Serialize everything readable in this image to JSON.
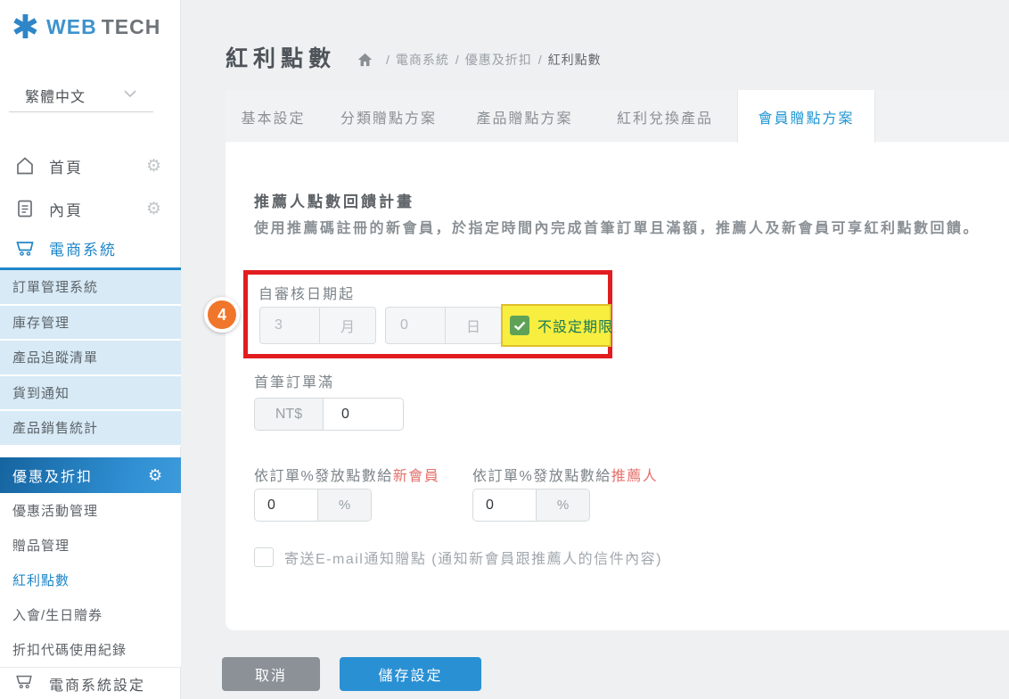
{
  "colors": {
    "brand_blue": "#2389cf",
    "active_tab_text": "#2196d3",
    "submenu_bg": "#d7eaf6",
    "annotation_red": "#e21d20",
    "badge_orange": "#f0762b",
    "highlight_yellow": "#f7ee3f",
    "checkbox_green": "#5fa257",
    "highlight_text_green": "#17795a",
    "label_red": "#e4716c",
    "cancel_gray": "#8b9197",
    "save_blue": "#2a90d4"
  },
  "icons": {
    "logo_mark": "✱",
    "language_chevron": "chevron-down",
    "home": "home-outline",
    "inner_page": "document-outline",
    "cart": "shopping-cart",
    "gear": "⚙",
    "breadcrumb_home": "house-solid",
    "checkmark": "✓"
  },
  "sidebar": {
    "logo": {
      "mark": "✱",
      "web": "WEB",
      "tech": "TECH"
    },
    "language": {
      "value": "繁體中文"
    },
    "menu": [
      {
        "label": "首頁"
      },
      {
        "label": "內頁"
      },
      {
        "label": "電商系統"
      }
    ],
    "submenu": [
      "訂單管理系統",
      "庫存管理",
      "產品追蹤清單",
      "貨到通知",
      "產品銷售統計"
    ],
    "promo_parent": "優惠及折扣",
    "promo_items": [
      "優惠活動管理",
      "贈品管理",
      "紅利點數",
      "入會/生日贈券",
      "折扣代碼使用紀錄"
    ],
    "active_item": "紅利點數",
    "footer_item": "電商系統設定"
  },
  "header": {
    "title": "紅利點數",
    "breadcrumb": [
      "電商系統",
      "優惠及折扣",
      "紅利點數"
    ],
    "separator": "/"
  },
  "tabs": {
    "items": [
      "基本設定",
      "分類贈點方案",
      "產品贈點方案",
      "紅利兌換產品",
      "會員贈點方案"
    ],
    "active": "會員贈點方案"
  },
  "content": {
    "heading": "推薦人點數回饋計畫",
    "description": "使用推薦碼註冊的新會員，於指定時間內完成首筆訂單且滿額，推薦人及新會員可享紅利點數回饋。",
    "annotation_badge": "4",
    "review_date": {
      "label": "自審核日期起",
      "month_value": "3",
      "month_unit": "月",
      "day_value": "0",
      "day_unit": "日",
      "no_limit_label": "不設定期限",
      "no_limit_checked": true
    },
    "first_order": {
      "label": "首筆訂單滿",
      "currency": "NT$",
      "value": "0"
    },
    "percent_new": {
      "label_prefix": "依訂單%發放點數給",
      "label_highlight": "新會員",
      "value": "0",
      "unit": "%"
    },
    "percent_referrer": {
      "label_prefix": "依訂單%發放點數給",
      "label_highlight": "推薦人",
      "value": "0",
      "unit": "%"
    },
    "email_notify": {
      "label": "寄送E-mail通知贈點 (通知新會員跟推薦人的信件內容)",
      "checked": false
    }
  },
  "footer": {
    "cancel": "取消",
    "save": "儲存設定"
  }
}
